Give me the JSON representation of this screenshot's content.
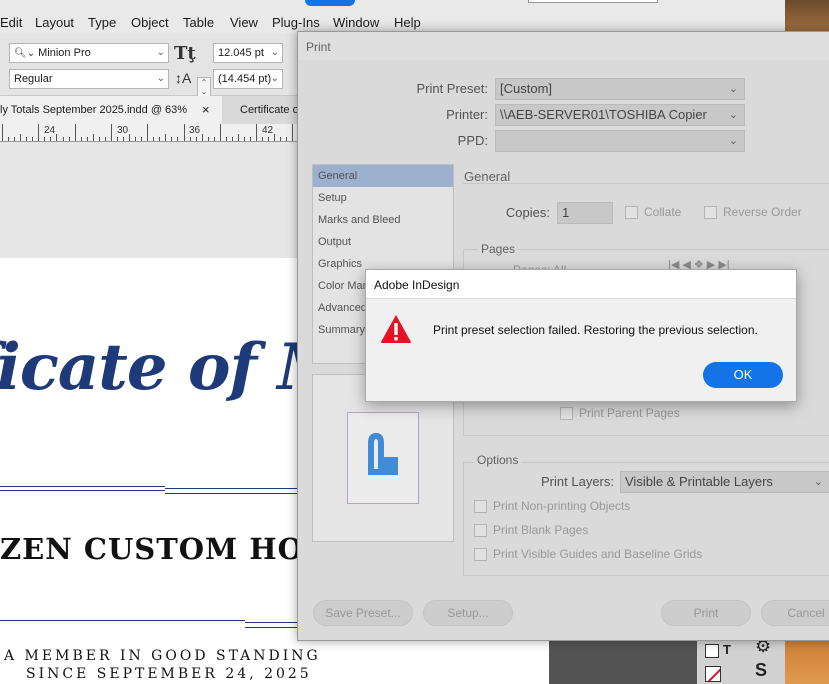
{
  "menu": [
    "Edit",
    "Layout",
    "Type",
    "Object",
    "Table",
    "View",
    "Plug-Ins",
    "Window",
    "Help"
  ],
  "control": {
    "font_family": "Minion Pro",
    "font_style": "Regular",
    "font_size": "12.045 pt",
    "leading": "(14.454 pt)"
  },
  "tabs": {
    "active": "ly Totals September 2025.indd @ 63%",
    "close": "×",
    "other": "Certificate o"
  },
  "ruler": [
    "24",
    "30",
    "36",
    "42"
  ],
  "document": {
    "title": "ficate of Memb",
    "company": "ZEN CUSTOM HOME",
    "line1": "A MEMBER IN GOOD STANDING",
    "line2": "SINCE SEPTEMBER 24, 2025"
  },
  "print": {
    "title": "Print",
    "preset_label": "Print Preset:",
    "preset_value": "[Custom]",
    "printer_label": "Printer:",
    "printer_value": "\\\\AEB-SERVER01\\TOSHIBA Copier",
    "ppd_label": "PPD:",
    "ppd_value": "",
    "categories": [
      "General",
      "Setup",
      "Marks and Bleed",
      "Output",
      "Graphics",
      "Color Mana",
      "Advanced",
      "Summary"
    ],
    "section_general": "General",
    "copies_label": "Copies:",
    "copies_value": "1",
    "collate": "Collate",
    "reverse_order": "Reverse Order",
    "pages_label": "Pages",
    "pages_sub": "Pages:",
    "pages_all": "All",
    "print_parent_pages": "Print Parent Pages",
    "options_label": "Options",
    "print_layers_label": "Print Layers:",
    "print_layers_value": "Visible & Printable Layers",
    "opt_nonprinting": "Print Non-printing Objects",
    "opt_blank": "Print Blank Pages",
    "opt_guides": "Print Visible Guides and Baseline Grids",
    "btn_save_preset": "Save Preset...",
    "btn_setup": "Setup...",
    "btn_print": "Print",
    "btn_cancel": "Cancel"
  },
  "alert": {
    "title": "Adobe InDesign",
    "message": "Print preset selection failed.  Restoring the previous selection.",
    "ok": "OK",
    "icon": "warning-icon",
    "icon_color": "#e81123"
  },
  "colors": {
    "accent": "#1473e6",
    "certificate_blue": "#1e3a78"
  }
}
